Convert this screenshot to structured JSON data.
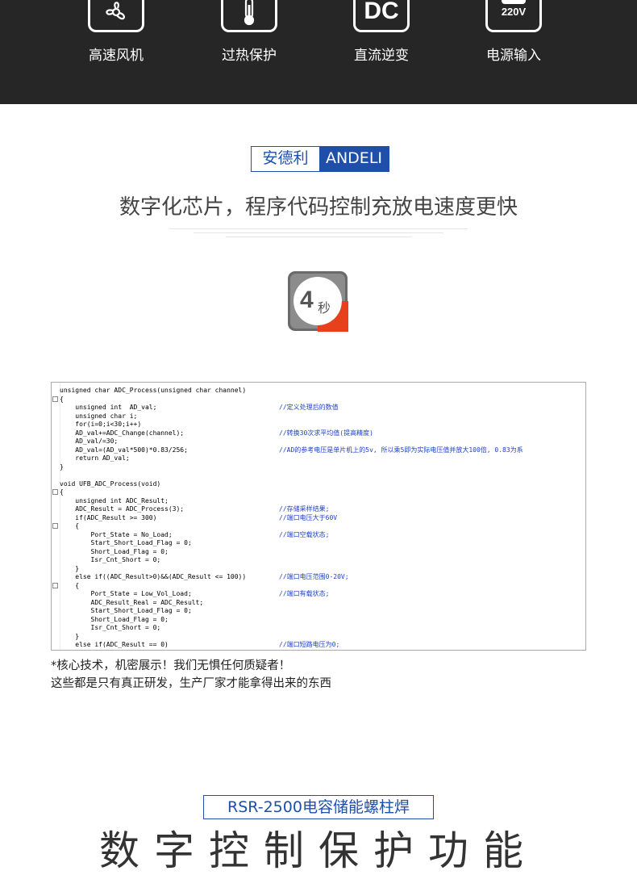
{
  "features": [
    {
      "icon": "fan-icon",
      "label": "高速风机"
    },
    {
      "icon": "thermometer-icon",
      "label": "过热保护"
    },
    {
      "icon": "dc-icon",
      "label": "直流逆变",
      "icon_text": "DC"
    },
    {
      "icon": "power-plug-icon",
      "label": "电源输入",
      "icon_text": "220V"
    }
  ],
  "brand": {
    "cn": "安德利",
    "en": "ANDELI",
    "color": "#1f4fa8"
  },
  "headline": "数字化芯片，程序代码控制充放电速度更快",
  "badge": {
    "icon": "timer-4s-icon",
    "number": "4",
    "unit": "秒",
    "accent": "#e8401c"
  },
  "code": {
    "lines": [
      {
        "t": "unsigned char ADC_Process(unsigned char channel)"
      },
      {
        "t": "{"
      },
      {
        "t": "    unsigned int  AD_val;",
        "c": "//定义处理后的数值"
      },
      {
        "t": "    unsigned char i;"
      },
      {
        "t": "    for(i=0;i<30;i++)"
      },
      {
        "t": "    AD_val+=ADC_Change(channel);",
        "c": "//转换30次求平均值(提高精度)"
      },
      {
        "t": "    AD_val/=30;"
      },
      {
        "t": "    AD_val=(AD_val*500)*0.83/256;",
        "c": "//AD的参考电压是单片机上的5v, 所以乘5即为实际电压值并放大100倍, 0.83为系"
      },
      {
        "t": "    return AD_val;"
      },
      {
        "t": "}"
      },
      {
        "t": ""
      },
      {
        "t": "void UFB_ADC_Process(void)"
      },
      {
        "t": "{"
      },
      {
        "t": "    unsigned int ADC_Result;"
      },
      {
        "t": "    ADC_Result = ADC_Process(3);",
        "c": "//存储采样结果;"
      },
      {
        "t": "    if(ADC_Result >= 300)",
        "c": "//端口电压大于60V"
      },
      {
        "t": "    {"
      },
      {
        "t": "        Port_State = No_Load;",
        "c": "//端口空载状态;"
      },
      {
        "t": "        Start_Short_Load_Flag = 0;"
      },
      {
        "t": "        Short_Load_Flag = 0;"
      },
      {
        "t": "        Isr_Cnt_Short = 0;"
      },
      {
        "t": "    }"
      },
      {
        "t": "    else if((ADC_Result>0)&&(ADC_Result <= 100))",
        "c": "//端口电压范围0-20V;"
      },
      {
        "t": "    {"
      },
      {
        "t": "        Port_State = Low_Vol_Load;",
        "c": "//端口有载状态;"
      },
      {
        "t": "        ADC_Result_Real = ADC_Result;"
      },
      {
        "t": "        Start_Short_Load_Flag = 0;"
      },
      {
        "t": "        Short_Load_Flag = 0;"
      },
      {
        "t": "        Isr_Cnt_Short = 0;"
      },
      {
        "t": "    }"
      },
      {
        "t": "    else if(ADC_Result == 0)",
        "c": "//端口短路电压为0;"
      }
    ]
  },
  "notes": [
    "*核心技术，机密展示！我们无惧任何质疑者！",
    "这些都是只有真正研发，生产厂家才能拿得出来的东西"
  ],
  "product": {
    "title": "RSR-2500电容储能螺柱焊"
  },
  "bottom_heading": "数字控制保护功能"
}
